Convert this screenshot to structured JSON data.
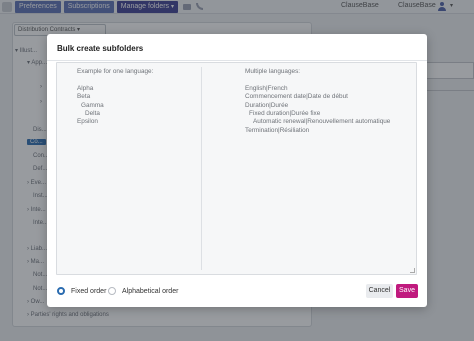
{
  "topbar": {
    "tabs": [
      {
        "label": "Preferences"
      },
      {
        "label": "Subscriptions"
      },
      {
        "label": "Manage folders"
      }
    ],
    "tab_caret": "▾",
    "app_name": "ClauseBase",
    "user_name": "ClauseBase",
    "user_caret": "▾",
    "icons": [
      "grid-icon",
      "camera-icon",
      "rss-icon",
      "user-icon"
    ]
  },
  "background": {
    "select_value": "Distribution Contracts",
    "select_caret": "▾",
    "rows": [
      {
        "text": "▾ Illust..."
      },
      {
        "text": "▾ App..."
      },
      {
        "text": "›"
      },
      {
        "text": "›"
      },
      {
        "text": "Dis..."
      },
      {
        "text": "Co...",
        "selected": true
      },
      {
        "text": "Con..."
      },
      {
        "text": "Def..."
      },
      {
        "text": "› Eve..."
      },
      {
        "text": "Inst..."
      },
      {
        "text": "› Inte..."
      },
      {
        "text": "Inte..."
      },
      {
        "text": "› Liab..."
      },
      {
        "text": "› Ma..."
      },
      {
        "text": "Not..."
      },
      {
        "text": "Not..."
      },
      {
        "text": "› Ow..."
      },
      {
        "text": "› Parties' rights and obligations"
      }
    ]
  },
  "modal": {
    "title": "Bulk create subfolders",
    "left_column": {
      "heading": "Example for one language:",
      "lines": [
        "Alpha",
        "Beta",
        "Gamma",
        "Delta",
        "Epsilon"
      ],
      "indents": [
        0,
        0,
        1,
        2,
        0
      ]
    },
    "right_column": {
      "heading": "Multiple languages:",
      "lines": [
        "English|French",
        "Commencement date|Date de début",
        "Duration|Durée",
        "Fixed duration|Durée fixe",
        "Automatic renewal|Renouvellement automatique",
        "Termination|Résiliation"
      ],
      "indents": [
        0,
        0,
        0,
        1,
        2,
        0
      ]
    },
    "order_options": [
      {
        "label": "Fixed order",
        "checked": true
      },
      {
        "label": "Alphabetical order",
        "checked": false
      }
    ],
    "cancel_label": "Cancel",
    "save_label": "Save",
    "colors": {
      "accent": "#2b6cb0",
      "save": "#c01a7e",
      "active_tab": "#3d3f93"
    }
  }
}
